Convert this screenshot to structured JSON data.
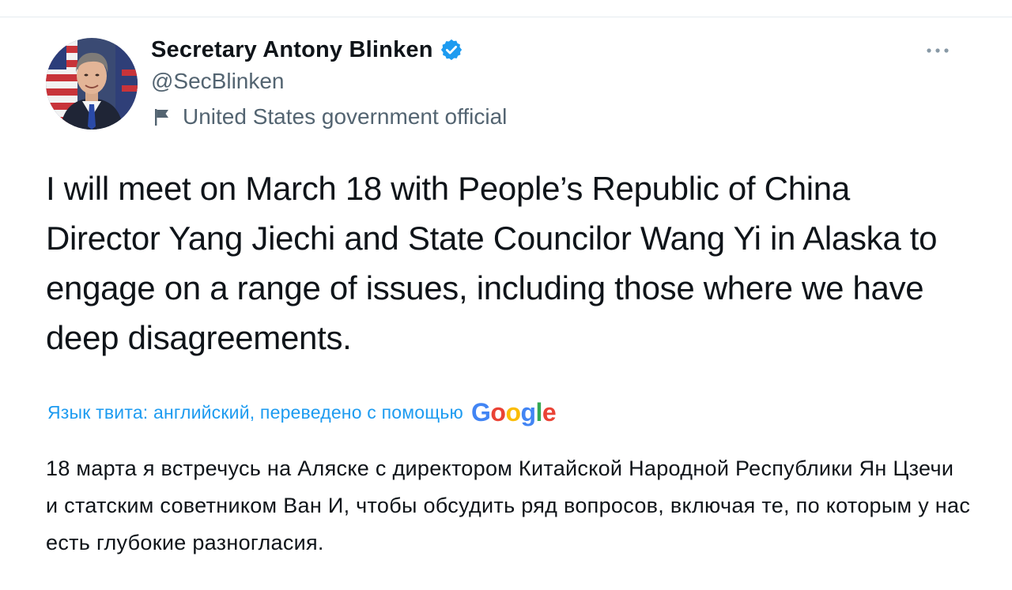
{
  "tweet": {
    "author": {
      "display_name": "Secretary Antony Blinken",
      "handle": "@SecBlinken",
      "verified": true,
      "account_label": "United States government official",
      "avatar_icon": "profile-photo"
    },
    "more_icon": "more-horizontal-icon",
    "text": "I will meet on March 18 with People’s Republic of China Director Yang Jiechi and State Councilor Wang Yi in Alaska to engage on a range of issues, including those where we have deep disagreements.",
    "translation": {
      "note": "Язык твита: английский, переведено с помощью",
      "provider_logo": [
        "G",
        "o",
        "o",
        "g",
        "l",
        "e"
      ],
      "text": "18 марта я встречусь на Аляске с директором Китайской Народной Республики Ян Цзечи и статским советником Ван И, чтобы обсудить ряд вопросов, включая те, по которым у нас есть глубокие разногласия."
    }
  },
  "colors": {
    "text_primary": "#0f1419",
    "text_secondary": "#536471",
    "accent": "#1d9bf0",
    "verified_badge": "#1d9bf0",
    "divider": "#e6ecf0"
  }
}
